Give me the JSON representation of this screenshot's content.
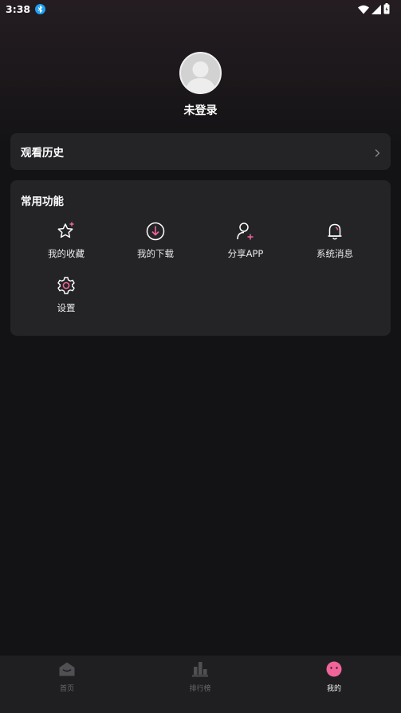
{
  "status_bar": {
    "time": "3:38",
    "app_icon": "bluetooth-app-icon",
    "icons": [
      "wifi-icon",
      "cell-signal-icon",
      "battery-icon"
    ]
  },
  "profile": {
    "avatar": "default-avatar",
    "name": "未登录"
  },
  "history": {
    "label": "观看历史",
    "icon": "chevron-right-icon"
  },
  "functions": {
    "title": "常用功能",
    "items": [
      {
        "label": "我的收藏",
        "icon": "star-plus-icon"
      },
      {
        "label": "我的下载",
        "icon": "download-icon"
      },
      {
        "label": "分享APP",
        "icon": "user-plus-icon"
      },
      {
        "label": "系统消息",
        "icon": "bell-icon"
      },
      {
        "label": "设置",
        "icon": "gear-icon"
      }
    ]
  },
  "bottom_nav": {
    "items": [
      {
        "label": "首页",
        "icon": "home-icon",
        "active": false
      },
      {
        "label": "排行榜",
        "icon": "ranking-icon",
        "active": false
      },
      {
        "label": "我的",
        "icon": "face-icon",
        "active": true
      }
    ]
  },
  "colors": {
    "accent": "#f0649a",
    "card": "#242427",
    "background": "#131316",
    "nav_inactive": "#6a6a6e"
  }
}
